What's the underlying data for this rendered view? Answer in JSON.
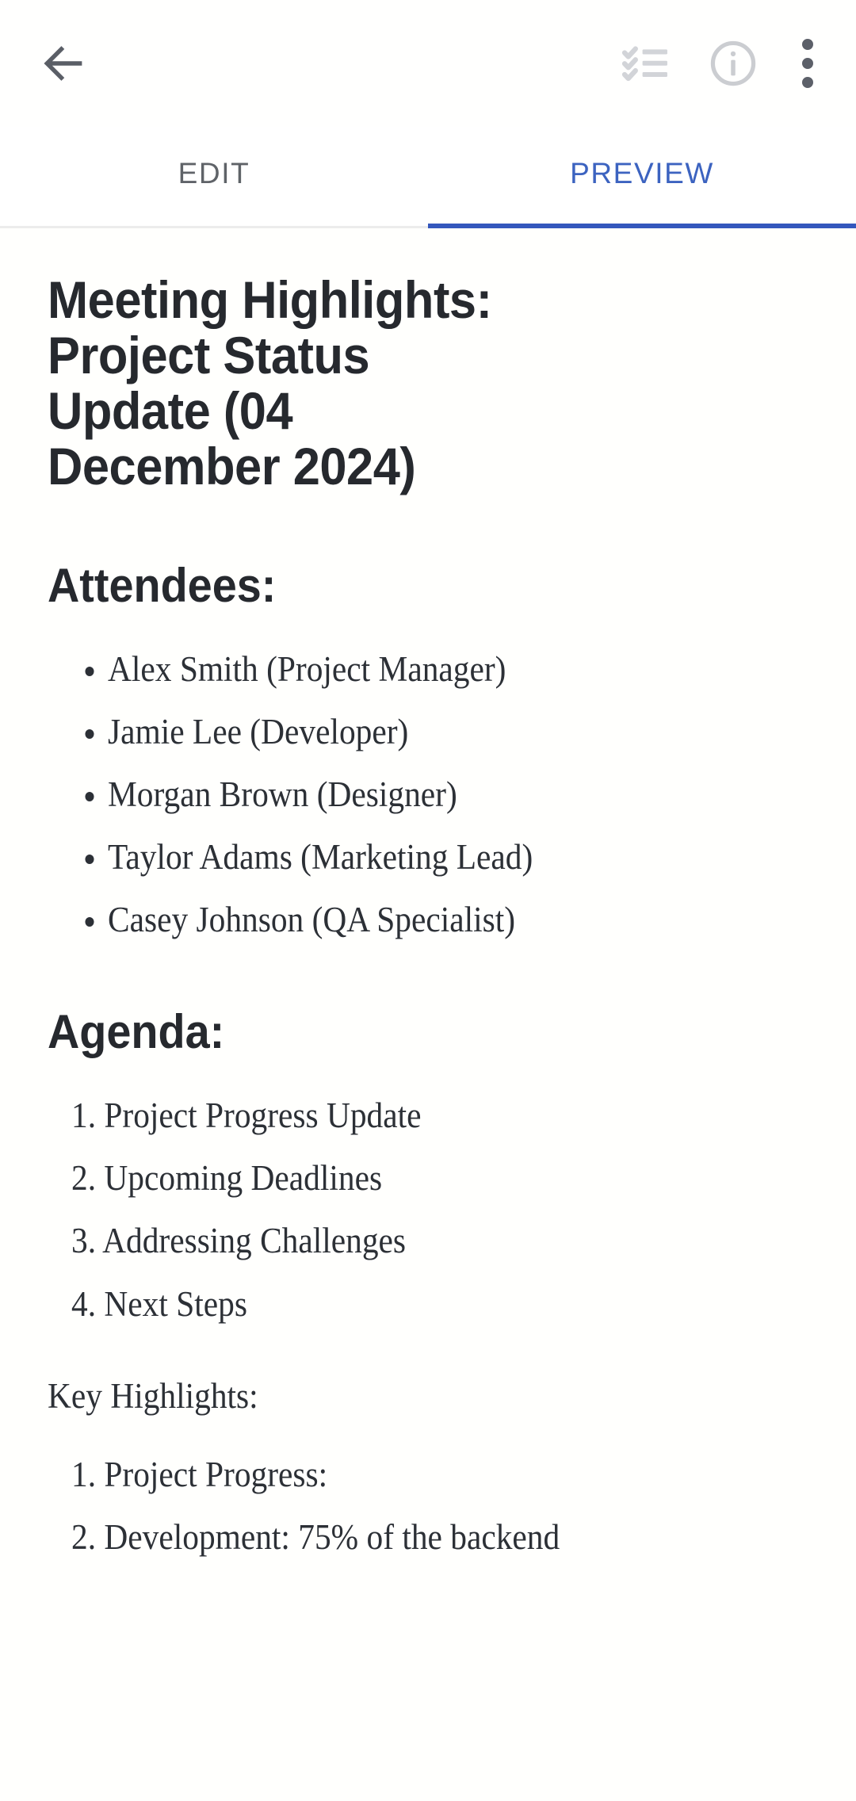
{
  "appbar": {
    "back_label": "Back",
    "actions": [
      {
        "name": "checklist-icon",
        "label": "Toggle checklist"
      },
      {
        "name": "info-icon",
        "label": "Document info"
      },
      {
        "name": "overflow-icon",
        "label": "More options"
      }
    ]
  },
  "tabs": [
    {
      "label": "EDIT",
      "active": false
    },
    {
      "label": "PREVIEW",
      "active": true
    }
  ],
  "colors": {
    "accent_blue": "#3c63c0",
    "indicator_blue": "#3457bd",
    "tab_inactive": "#5f6368",
    "heading": "#26292e",
    "body_text": "#2c3036",
    "icon_dark": "#5c6069",
    "icon_light": "#cfd1d5",
    "page_background": "#fffffd"
  },
  "document": {
    "title": "Meeting Highlights: Project Status Update (04 December 2024)",
    "attendees_heading": "Attendees:",
    "attendees": [
      "Alex Smith (Project Manager)",
      "Jamie Lee (Developer)",
      "Morgan Brown (Designer)",
      "Taylor Adams (Marketing Lead)",
      "Casey Johnson (QA Specialist)"
    ],
    "agenda_heading": "Agenda:",
    "agenda": [
      "Project Progress Update",
      "Upcoming Deadlines",
      "Addressing Challenges",
      "Next Steps"
    ],
    "key_highlights_label": "Key Highlights:",
    "key_highlights": [
      "Project Progress:",
      "Development: 75% of the backend"
    ]
  }
}
